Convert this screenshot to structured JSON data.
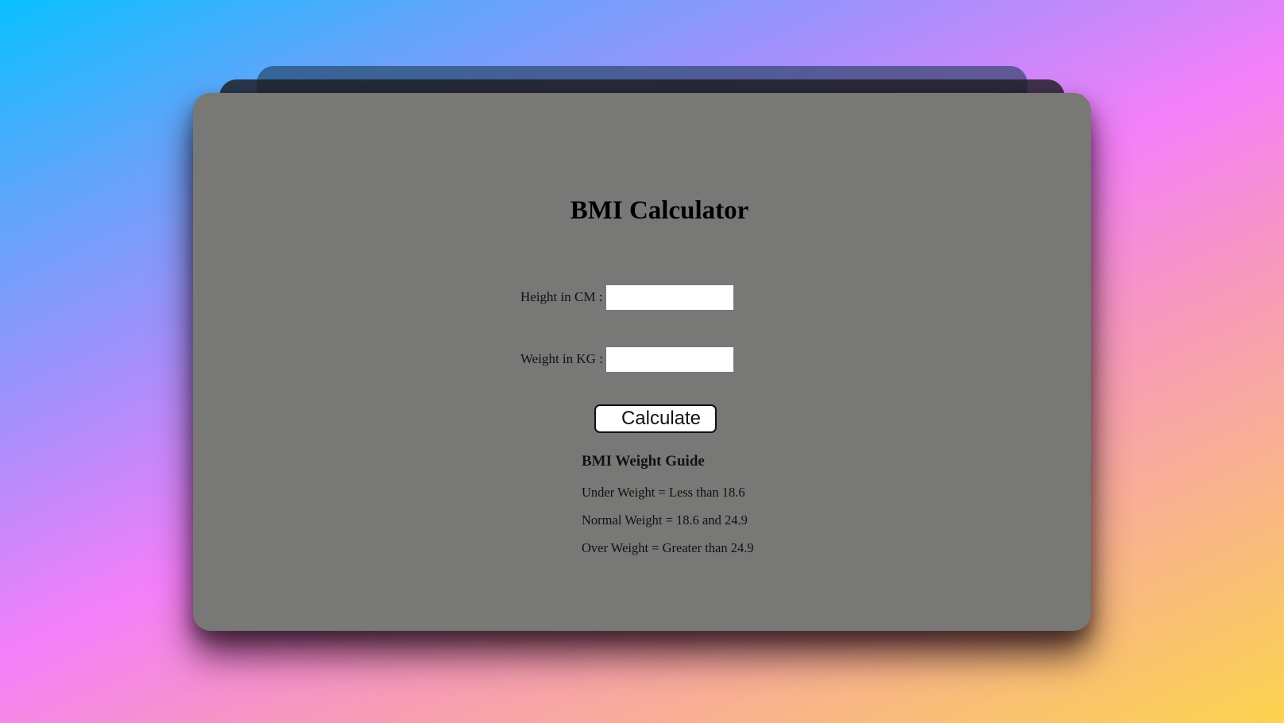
{
  "page": {
    "title": "BMI Calculator"
  },
  "form": {
    "height": {
      "label": "Height in CM :",
      "value": ""
    },
    "weight": {
      "label": "Weight in KG :",
      "value": ""
    },
    "calculate_label": "Calculate"
  },
  "guide": {
    "title": "BMI Weight Guide",
    "items": [
      "Under Weight = Less than 18.6",
      "Normal Weight = 18.6 and 24.9",
      "Over Weight = Greater than 24.9"
    ]
  },
  "colors": {
    "card_background": "#787876",
    "input_background": "#ffffff",
    "text": "#111111"
  }
}
